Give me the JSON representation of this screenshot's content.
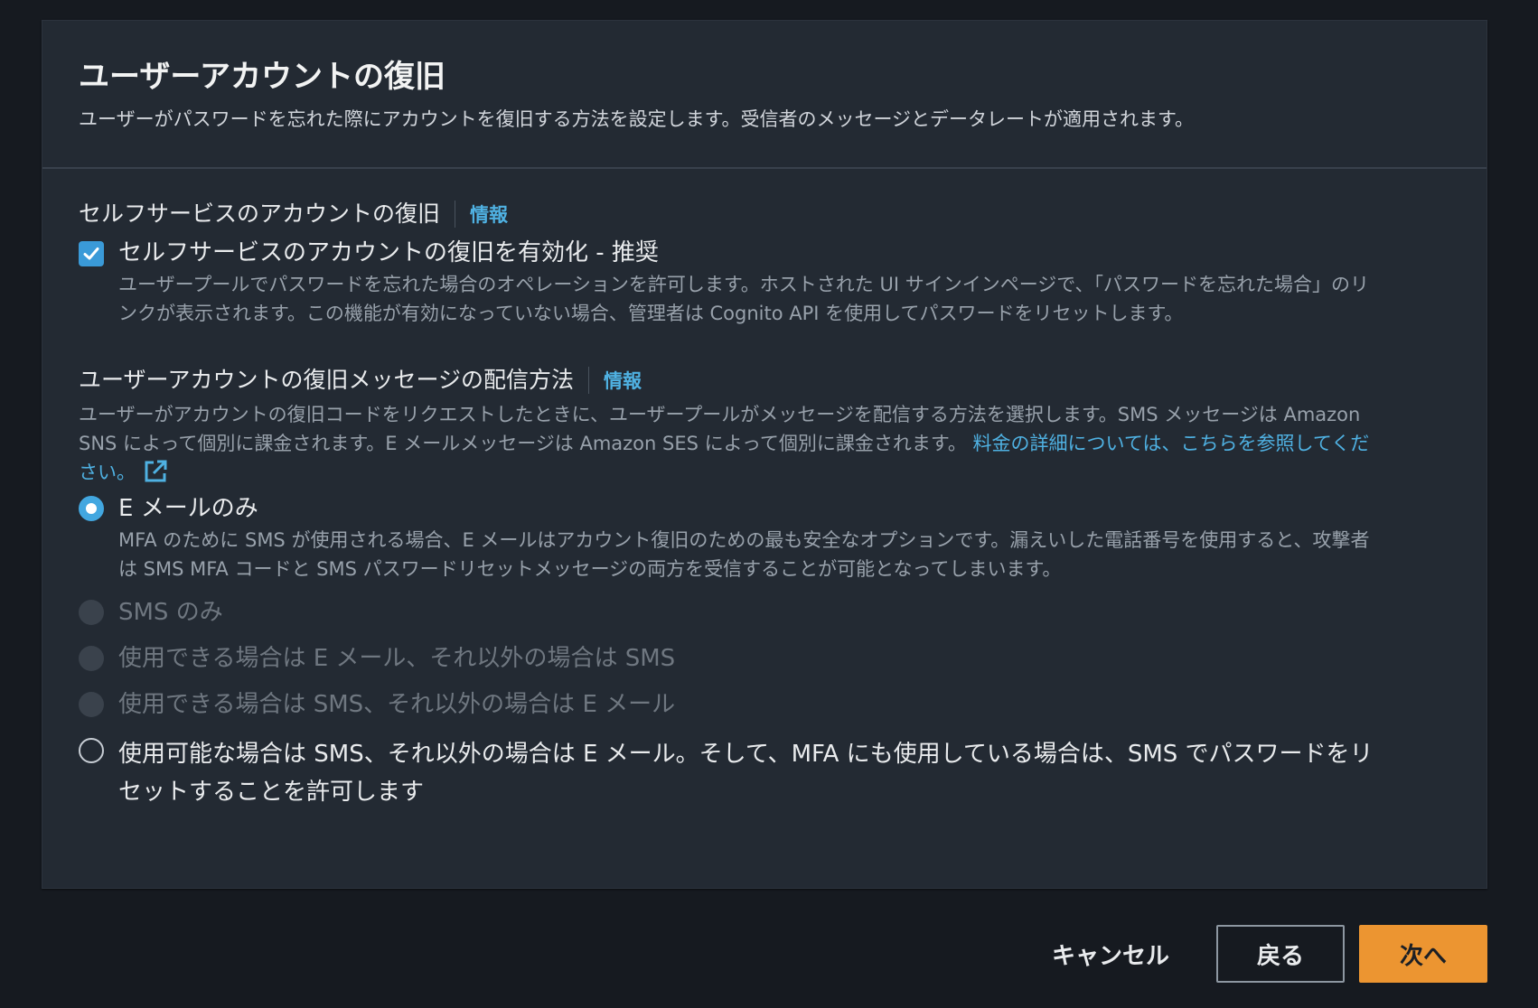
{
  "header": {
    "title": "ユーザーアカウントの復旧",
    "description": "ユーザーがパスワードを忘れた際にアカウントを復旧する方法を設定します。受信者のメッセージとデータレートが適用されます。"
  },
  "self_service": {
    "title": "セルフサービスのアカウントの復旧",
    "info_label": "情報",
    "checkbox_checked": true,
    "checkbox_label": "セルフサービスのアカウントの復旧を有効化 - 推奨",
    "checkbox_desc": "ユーザープールでパスワードを忘れた場合のオペレーションを許可します。ホストされた UI サインインページで、「パスワードを忘れた場合」のリンクが表示されます。この機能が有効になっていない場合、管理者は Cognito API を使用してパスワードをリセットします。"
  },
  "delivery": {
    "title": "ユーザーアカウントの復旧メッセージの配信方法",
    "info_label": "情報",
    "description": "ユーザーがアカウントの復旧コードをリクエストしたときに、ユーザープールがメッセージを配信する方法を選択します。SMS メッセージは Amazon SNS によって個別に課金されます。E メールメッセージは Amazon SES によって個別に課金されます。",
    "pricing_link": "料金の詳細については、こちらを参照してください。",
    "options": [
      {
        "label": "E メールのみ",
        "desc": "MFA のために SMS が使用される場合、E メールはアカウント復旧のための最も安全なオプションです。漏えいした電話番号を使用すると、攻撃者は SMS MFA コードと SMS パスワードリセットメッセージの両方を受信することが可能となってしまいます。"
      },
      {
        "label": "SMS のみ"
      },
      {
        "label": "使用できる場合は E メール、それ以外の場合は SMS"
      },
      {
        "label": "使用できる場合は SMS、それ以外の場合は E メール"
      },
      {
        "label": "使用可能な場合は SMS、それ以外の場合は E メール。そして、MFA にも使用している場合は、SMS でパスワードをリセットすることを許可します"
      }
    ]
  },
  "footer": {
    "cancel": "キャンセル",
    "back": "戻る",
    "next": "次へ"
  },
  "colors": {
    "accent": "#42a7e0",
    "primary_button": "#ec9531",
    "link": "#4fb1e2"
  }
}
